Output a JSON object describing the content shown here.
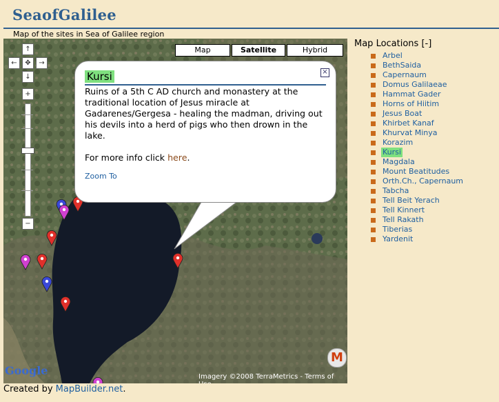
{
  "page": {
    "title": "SeaofGalilee",
    "subtitle": "Map of the sites in Sea of Galilee region"
  },
  "map": {
    "types": [
      "Map",
      "Satellite",
      "Hybrid"
    ],
    "active_type": "Satellite",
    "nav": {
      "up": "↑",
      "left": "←",
      "center": "✥",
      "right": "→",
      "down": "↓"
    },
    "zoom": {
      "in": "+",
      "out": "−"
    },
    "logo": "Google",
    "imagery": "Imagery ©2008 TerraMetrics - ",
    "terms": "Terms of Use",
    "badge": "M"
  },
  "infowindow": {
    "title": "Kursi",
    "description": "Ruins of  a 5th C AD church and monastery at the traditional location of Jesus miracle at Gadarenes/Gergesa - healing the madman, driving out his devils into a herd of pigs who then drown in the lake.",
    "more_prefix": "For more info click ",
    "more_link": "here",
    "more_suffix": ".",
    "zoom_link": "Zoom To",
    "close": "×"
  },
  "locations": {
    "header": "Map Locations",
    "toggle": "[-]",
    "selected": "Kursi",
    "items": [
      "Arbel",
      "BethSaida",
      "Capernaum",
      "Domus Galilaeae",
      "Hammat Gader",
      "Horns of Hiitim",
      "Jesus Boat",
      "Khirbet Kanaf",
      "Khurvat Minya",
      "Korazim",
      "Kursi",
      "Magdala",
      "Mount Beatitudes",
      "Orth.Ch., Capernaum",
      "Tabcha",
      "Tell Beit Yerach",
      "Tell Kinnert",
      "Tell Rakath",
      "Tiberias",
      "Yardenit"
    ]
  },
  "footer": {
    "prefix": "Created by ",
    "link": "MapBuilder.net",
    "suffix": "."
  },
  "colors": {
    "title": "#2f5f8f",
    "background": "#f6e9c9",
    "link": "#1f5fa0",
    "highlight": "#7fe07f",
    "marker_red": "#e0302a",
    "marker_pink": "#d040d0",
    "marker_blue": "#3040d0"
  }
}
